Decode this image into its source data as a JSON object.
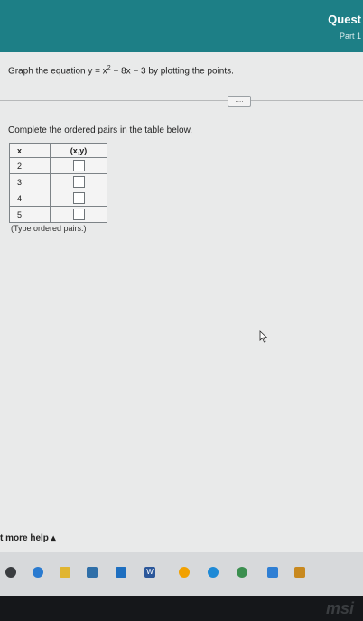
{
  "header": {
    "title": "Quest",
    "part": "Part 1"
  },
  "question": {
    "instruction_prefix": "Graph the equation y = x",
    "exponent": "2",
    "instruction_suffix": " − 8x − 3 by plotting the points.",
    "more_button": "....",
    "table_prompt": "Complete the ordered pairs in the table below.",
    "table": {
      "headers": [
        "x",
        "(x,y)"
      ],
      "rows": [
        {
          "x": "2"
        },
        {
          "x": "3"
        },
        {
          "x": "4"
        },
        {
          "x": "5"
        }
      ]
    },
    "hint": "(Type ordered pairs.)"
  },
  "footer": {
    "help": "t more help ▴"
  },
  "taskbar": {
    "icons": [
      "start-icon",
      "search-icon",
      "files-icon",
      "browser-icon",
      "mail-icon",
      "word-icon",
      "chrome-icon",
      "media-icon",
      "game-icon"
    ]
  },
  "bezel": {
    "brand": "msi"
  }
}
